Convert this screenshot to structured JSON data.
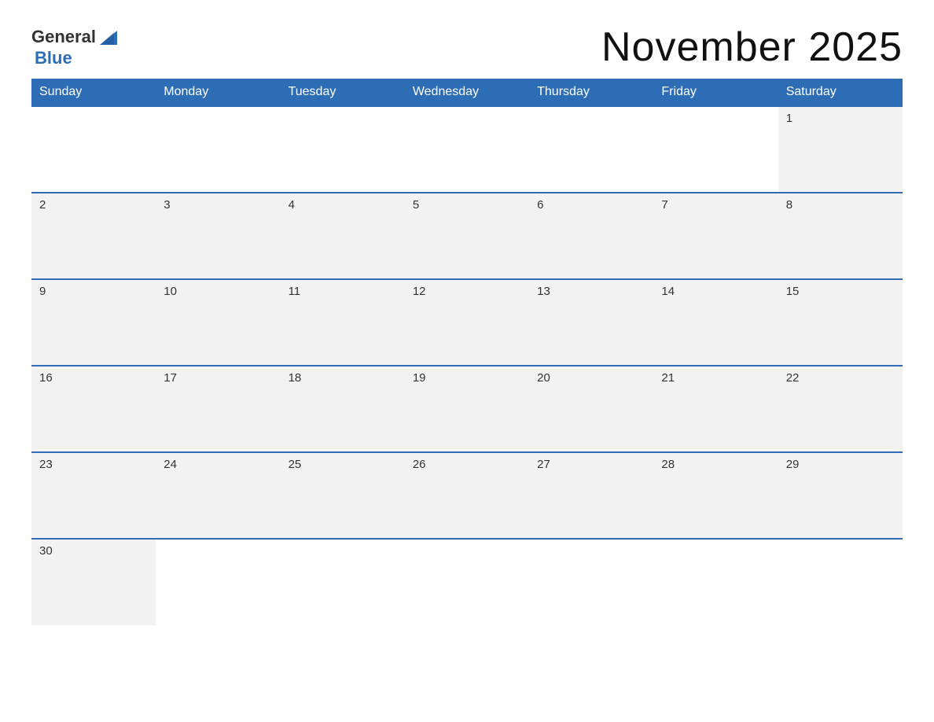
{
  "header": {
    "logo": {
      "general": "General",
      "blue": "Blue"
    },
    "title": "November 2025"
  },
  "calendar": {
    "days_of_week": [
      "Sunday",
      "Monday",
      "Tuesday",
      "Wednesday",
      "Thursday",
      "Friday",
      "Saturday"
    ],
    "weeks": [
      [
        {
          "date": "",
          "empty": true
        },
        {
          "date": "",
          "empty": true
        },
        {
          "date": "",
          "empty": true
        },
        {
          "date": "",
          "empty": true
        },
        {
          "date": "",
          "empty": true
        },
        {
          "date": "",
          "empty": true
        },
        {
          "date": "1",
          "empty": false
        }
      ],
      [
        {
          "date": "2",
          "empty": false
        },
        {
          "date": "3",
          "empty": false
        },
        {
          "date": "4",
          "empty": false
        },
        {
          "date": "5",
          "empty": false
        },
        {
          "date": "6",
          "empty": false
        },
        {
          "date": "7",
          "empty": false
        },
        {
          "date": "8",
          "empty": false
        }
      ],
      [
        {
          "date": "9",
          "empty": false
        },
        {
          "date": "10",
          "empty": false
        },
        {
          "date": "11",
          "empty": false
        },
        {
          "date": "12",
          "empty": false
        },
        {
          "date": "13",
          "empty": false
        },
        {
          "date": "14",
          "empty": false
        },
        {
          "date": "15",
          "empty": false
        }
      ],
      [
        {
          "date": "16",
          "empty": false
        },
        {
          "date": "17",
          "empty": false
        },
        {
          "date": "18",
          "empty": false
        },
        {
          "date": "19",
          "empty": false
        },
        {
          "date": "20",
          "empty": false
        },
        {
          "date": "21",
          "empty": false
        },
        {
          "date": "22",
          "empty": false
        }
      ],
      [
        {
          "date": "23",
          "empty": false
        },
        {
          "date": "24",
          "empty": false
        },
        {
          "date": "25",
          "empty": false
        },
        {
          "date": "26",
          "empty": false
        },
        {
          "date": "27",
          "empty": false
        },
        {
          "date": "28",
          "empty": false
        },
        {
          "date": "29",
          "empty": false
        }
      ],
      [
        {
          "date": "30",
          "empty": false
        },
        {
          "date": "",
          "empty": true
        },
        {
          "date": "",
          "empty": true
        },
        {
          "date": "",
          "empty": true
        },
        {
          "date": "",
          "empty": true
        },
        {
          "date": "",
          "empty": true
        },
        {
          "date": "",
          "empty": true
        }
      ]
    ]
  }
}
